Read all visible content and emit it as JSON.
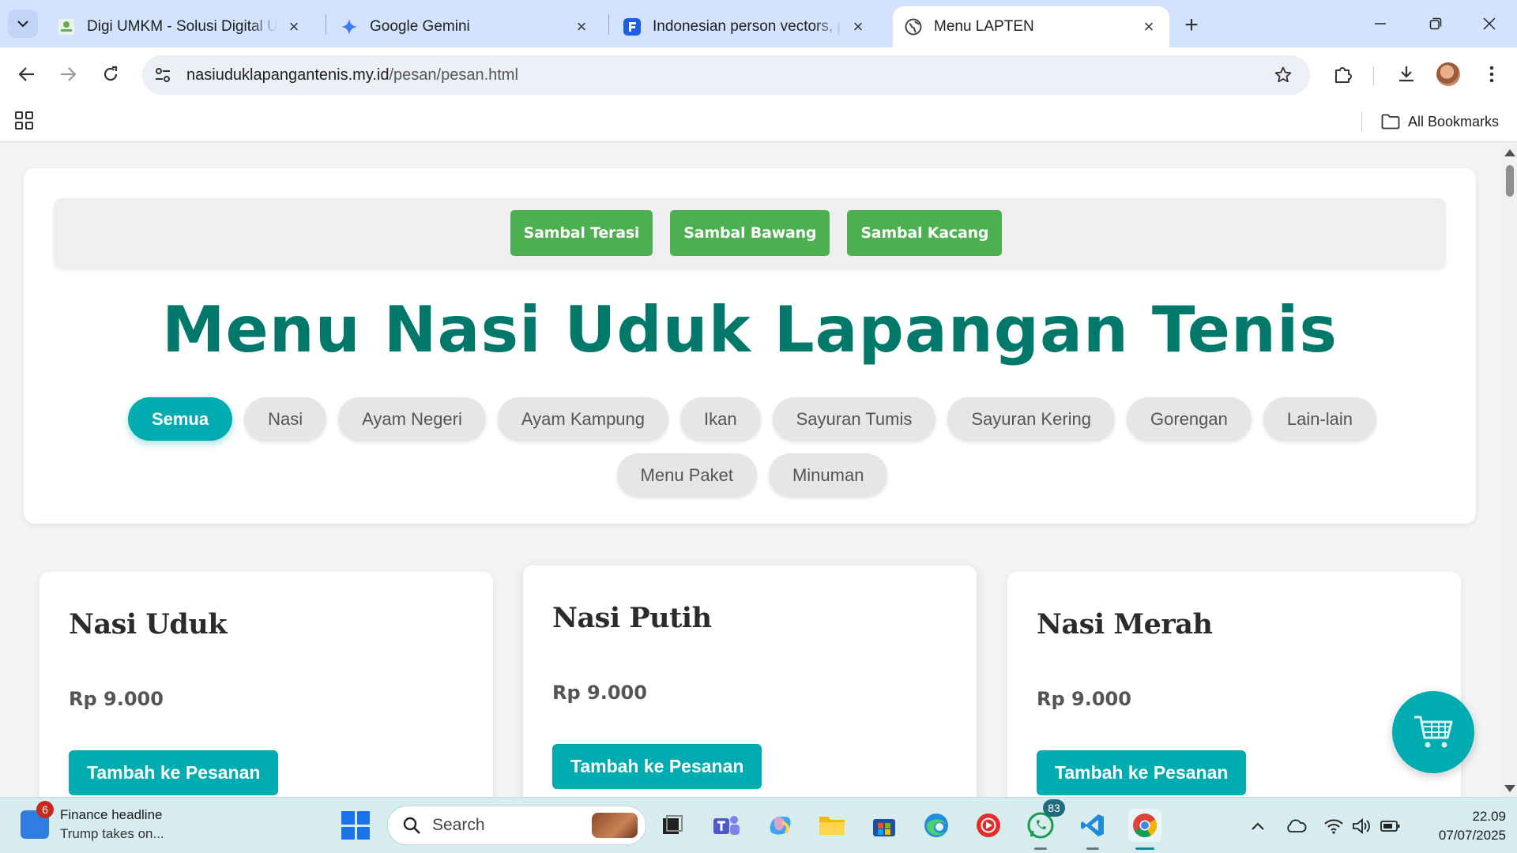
{
  "browser": {
    "tabs": [
      {
        "title": "Digi UMKM - Solusi Digital UMKM",
        "icon": "digi-umkm-favicon",
        "active": false
      },
      {
        "title": "Google Gemini",
        "icon": "gemini-sparkle-icon",
        "active": false
      },
      {
        "title": "Indonesian person vectors, photos",
        "icon": "freepik-favicon",
        "active": false
      },
      {
        "title": "Menu LAPTEN",
        "icon": "globe-icon",
        "active": true
      }
    ],
    "url_domain": "nasiuduklapangantenis.my.id",
    "url_path": "/pesan/pesan.html",
    "all_bookmarks_label": "All Bookmarks"
  },
  "page": {
    "sambal_buttons": [
      "Sambal Terasi",
      "Sambal Bawang",
      "Sambal Kacang"
    ],
    "title": "Menu Nasi Uduk Lapangan Tenis",
    "categories_row1": [
      "Semua",
      "Nasi",
      "Ayam Negeri",
      "Ayam Kampung",
      "Ikan",
      "Sayuran Tumis",
      "Sayuran Kering",
      "Gorengan",
      "Lain-lain"
    ],
    "categories_row2": [
      "Menu Paket",
      "Minuman"
    ],
    "active_category": "Semua",
    "menu_items": [
      {
        "name": "Nasi Uduk",
        "price": "Rp 9.000",
        "button": "Tambah ke Pesanan"
      },
      {
        "name": "Nasi Putih",
        "price": "Rp 9.000",
        "button": "Tambah ke Pesanan"
      },
      {
        "name": "Nasi Merah",
        "price": "Rp 9.000",
        "button": "Tambah ke Pesanan"
      }
    ],
    "colors": {
      "accent": "#00acb0",
      "title": "#00796b",
      "sambal": "#4caf50"
    }
  },
  "taskbar": {
    "news_title": "Finance headline",
    "news_sub": "Trump takes on...",
    "news_badge": "6",
    "search_label": "Search",
    "whatsapp_badge": "83",
    "time": "22.09",
    "date": "07/07/2025"
  }
}
